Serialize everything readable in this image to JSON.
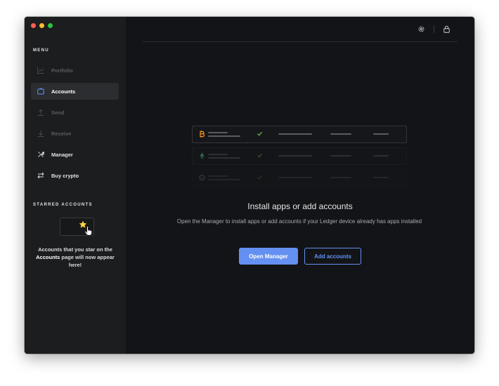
{
  "sidebar": {
    "menu_label": "MENU",
    "items": [
      {
        "label": "Portfolio",
        "icon": "chart-line-icon",
        "state": "disabled"
      },
      {
        "label": "Accounts",
        "icon": "wallet-icon",
        "state": "active"
      },
      {
        "label": "Send",
        "icon": "arrow-up-icon",
        "state": "disabled"
      },
      {
        "label": "Receive",
        "icon": "arrow-down-icon",
        "state": "disabled"
      },
      {
        "label": "Manager",
        "icon": "tools-icon",
        "state": "enabled"
      },
      {
        "label": "Buy crypto",
        "icon": "swap-arrows-icon",
        "state": "enabled"
      }
    ],
    "starred_label": "STARRED ACCOUNTS",
    "starred_hint": {
      "before": "Accounts that you star on the ",
      "bold": "Accounts",
      "after": " page will now appear here!"
    }
  },
  "topbar": {
    "icons": [
      "gear-icon",
      "lock-icon"
    ]
  },
  "empty_state": {
    "title": "Install apps or add accounts",
    "description": "Open the Manager to install apps or add accounts if your Ledger device already has apps installed",
    "primary_button": "Open Manager",
    "secondary_button": "Add accounts"
  },
  "colors": {
    "accent": "#6490f1",
    "active_nav_bg": "#2c2d30",
    "bitcoin": "#f7931a",
    "ethereum": "#3d9970",
    "star": "#ffd43b",
    "check": "#66be54"
  }
}
